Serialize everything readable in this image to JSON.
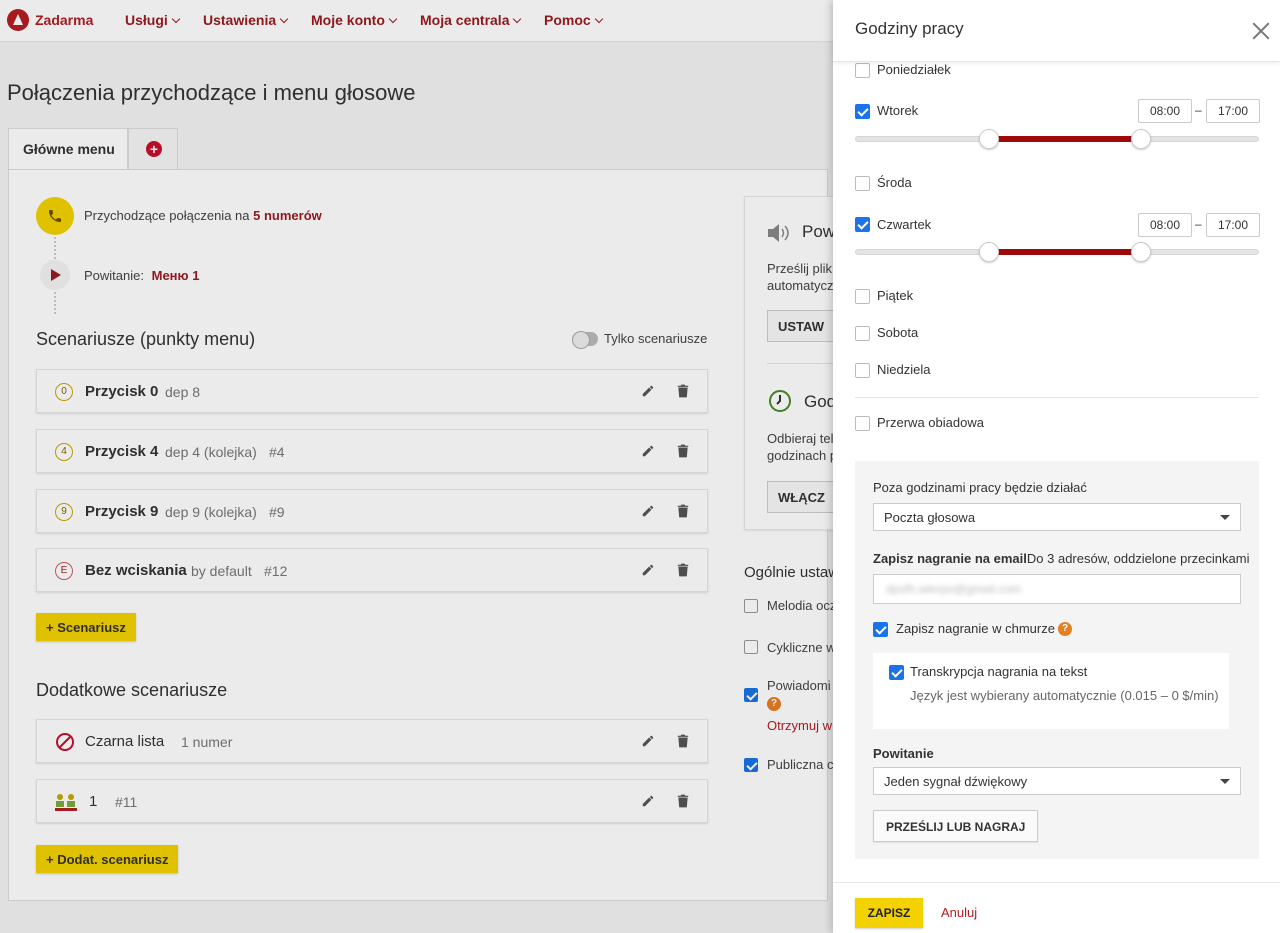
{
  "app": {
    "brand": "Zadarma",
    "brand_color": "#b31e23"
  },
  "nav": {
    "items": [
      "Usługi",
      "Ustawienia",
      "Moje konto",
      "Moja centrala",
      "Pomoc"
    ]
  },
  "page": {
    "title": "Połączenia przychodzące i menu głosowe"
  },
  "tabs": {
    "main": "Główne menu"
  },
  "flow": {
    "incoming_prefix": "Przychodzące połączenia na",
    "incoming_link": "5 numerów",
    "greeting_prefix": "Powitanie:",
    "greeting_link": "Меню 1"
  },
  "scenarios": {
    "title": "Scenariusze (punkty menu)",
    "toggle_label": "Tylko scenariusze",
    "items": [
      {
        "badge": "0",
        "title": "Przycisk 0",
        "meta": "dep 8",
        "num": ""
      },
      {
        "badge": "4",
        "title": "Przycisk 4",
        "meta": "dep 4 (kolejka)",
        "num": "#4"
      },
      {
        "badge": "9",
        "title": "Przycisk 9",
        "meta": "dep 9 (kolejka)",
        "num": "#9"
      },
      {
        "badge": "E",
        "title": "Bez wciskania",
        "meta": "by default",
        "num": "#12"
      }
    ],
    "add_button": "Scenariusz"
  },
  "additional": {
    "title": "Dodatkowe scenariusze",
    "items": [
      {
        "icon": "blacklist-icon",
        "title": "Czarna lista",
        "meta": "1 numer"
      },
      {
        "icon": "group-icon",
        "title": "1",
        "meta": "#11"
      }
    ],
    "add_button": "Dodat. scenariusz"
  },
  "right_card": {
    "voice_title": "Pow",
    "voice_text_1": "Prześlij plik",
    "voice_text_2": "automatycz",
    "set_button": "USTAW",
    "hours_title": "God",
    "hours_text_1": "Odbieraj tel",
    "hours_text_2": "godzinach p",
    "enable_button": "WŁĄCZ"
  },
  "general": {
    "title": "Ogólnie ustaw",
    "items": [
      {
        "label": "Melodia ocz",
        "checked": false
      },
      {
        "label": "Cykliczne w",
        "checked": false
      },
      {
        "label": "Powiadomi",
        "checked": true
      },
      {
        "label": "Publiczna c",
        "checked": true
      }
    ],
    "notify_sub": "Otrzymuj w"
  },
  "drawer": {
    "title": "Godziny pracy",
    "days": [
      {
        "label": "Poniedziałek",
        "checked": false
      },
      {
        "label": "Wtorek",
        "checked": true,
        "from": "08:00",
        "to": "17:00",
        "range": [
          0.33,
          0.71
        ]
      },
      {
        "label": "Środa",
        "checked": false
      },
      {
        "label": "Czwartek",
        "checked": true,
        "from": "08:00",
        "to": "17:00",
        "range": [
          0.33,
          0.71
        ]
      },
      {
        "label": "Piątek",
        "checked": false
      },
      {
        "label": "Sobota",
        "checked": false
      },
      {
        "label": "Niedziela",
        "checked": false
      }
    ],
    "time_separator": "–",
    "lunch_break": {
      "label": "Przerwa obiadowa",
      "checked": false
    },
    "after_hours_label": "Poza godzinami pracy będzie działać",
    "after_hours_value": "Poczta głosowa",
    "email_label": "Zapisz nagranie na email",
    "email_hint": "Do 3 adresów, oddzielone przecinkami",
    "email_value": "dpsfh.wlerpo@gmail.com",
    "cloud_label": "Zapisz nagranie w chmurze",
    "cloud_checked": true,
    "transcription_label": "Transkrypcja nagrania na tekst",
    "transcription_checked": true,
    "transcription_sub": "Język jest wybierany automatycznie (0.015 – 0 $/min)",
    "greeting_label": "Powitanie",
    "greeting_value": "Jeden sygnał dźwiękowy",
    "upload_button": "PRZEŚLIJ LUB NAGRAJ",
    "save_button": "ZAPISZ",
    "cancel_link": "Anuluj"
  },
  "colors": {
    "accent_yellow": "#f3d200",
    "slider_fill": "#9e0a0a",
    "check_blue": "#1a73e8"
  }
}
